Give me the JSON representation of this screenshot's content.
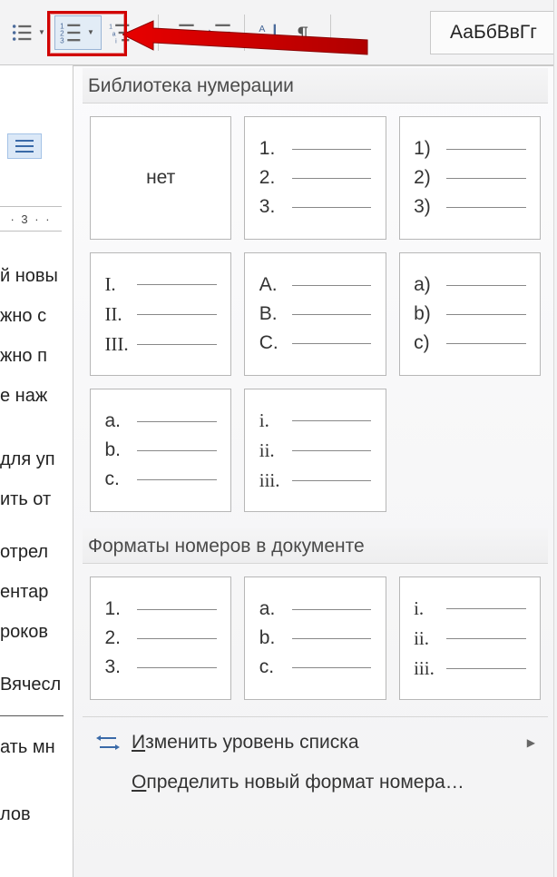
{
  "ribbon": {
    "style_preview": "АаБбВвГг"
  },
  "ruler": {
    "segment": "· 3 · ·"
  },
  "doc_text": {
    "l1": "й новы",
    "l2": "жно с",
    "l3": "жно п",
    "l4": "е наж",
    "l5": "для уп",
    "l6": "ить от",
    "l7": "отрел",
    "l8": "ентар",
    "l9": "роков",
    "l10": "Вячесл",
    "l11": "ать мн",
    "l12": "лов"
  },
  "panel": {
    "library_header": "Библиотека нумерации",
    "formats_header": "Форматы номеров в документе",
    "none_label": "нет",
    "tiles_library": [
      [
        "1.",
        "2.",
        "3."
      ],
      [
        "1)",
        "2)",
        "3)"
      ],
      [
        "I.",
        "II.",
        "III."
      ],
      [
        "A.",
        "B.",
        "C."
      ],
      [
        "a)",
        "b)",
        "c)"
      ],
      [
        "a.",
        "b.",
        "c."
      ],
      [
        "i.",
        "ii.",
        "iii."
      ]
    ],
    "tiles_formats": [
      [
        "1.",
        "2.",
        "3."
      ],
      [
        "a.",
        "b.",
        "c."
      ],
      [
        "i.",
        "ii.",
        "iii."
      ]
    ],
    "menu": {
      "change_level": "Изменить уровень списка",
      "define_new": "Определить новый формат номера…",
      "change_level_u": "И",
      "define_new_u": "О"
    }
  }
}
